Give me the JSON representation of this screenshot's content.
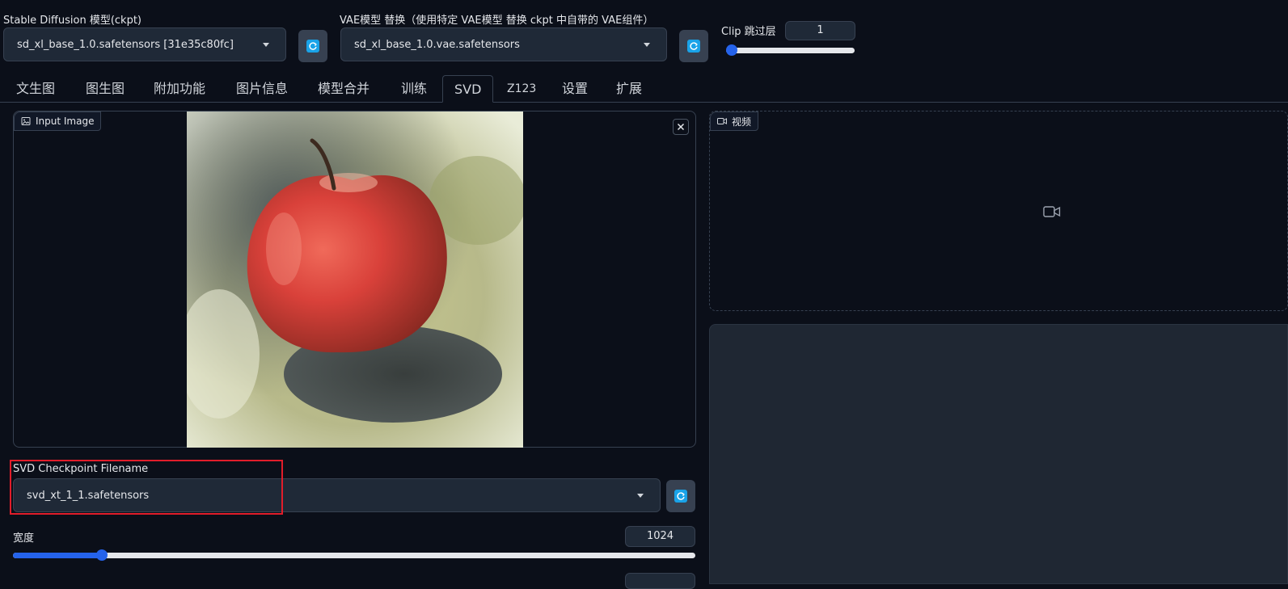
{
  "sd_model": {
    "label": "Stable Diffusion 模型(ckpt)",
    "value": "sd_xl_base_1.0.safetensors [31e35c80fc]"
  },
  "vae_model": {
    "label": "VAE模型 替换（使用特定 VAE模型 替换 ckpt 中自带的 VAE组件）",
    "value": "sd_xl_base_1.0.vae.safetensors"
  },
  "clip_skip": {
    "label": "Clip 跳过层",
    "value": "1",
    "fraction": 0.0
  },
  "tabs": [
    {
      "label": "文生图"
    },
    {
      "label": "图生图"
    },
    {
      "label": "附加功能"
    },
    {
      "label": "图片信息"
    },
    {
      "label": "模型合并"
    },
    {
      "label": "训练"
    },
    {
      "label": "SVD"
    },
    {
      "label": "Z123"
    },
    {
      "label": "设置"
    },
    {
      "label": "扩展"
    }
  ],
  "active_tab": "SVD",
  "input_image": {
    "label": "Input Image"
  },
  "video": {
    "label": "视频"
  },
  "svd_checkpoint": {
    "label": "SVD Checkpoint Filename",
    "value": "svd_xt_1_1.safetensors"
  },
  "width": {
    "label": "宽度",
    "value": "1024",
    "fraction": 0.13
  },
  "colors": {
    "accent": "#2563eb",
    "highlight": "#e11d2a",
    "refresh_icon": "#1aa3e8"
  }
}
